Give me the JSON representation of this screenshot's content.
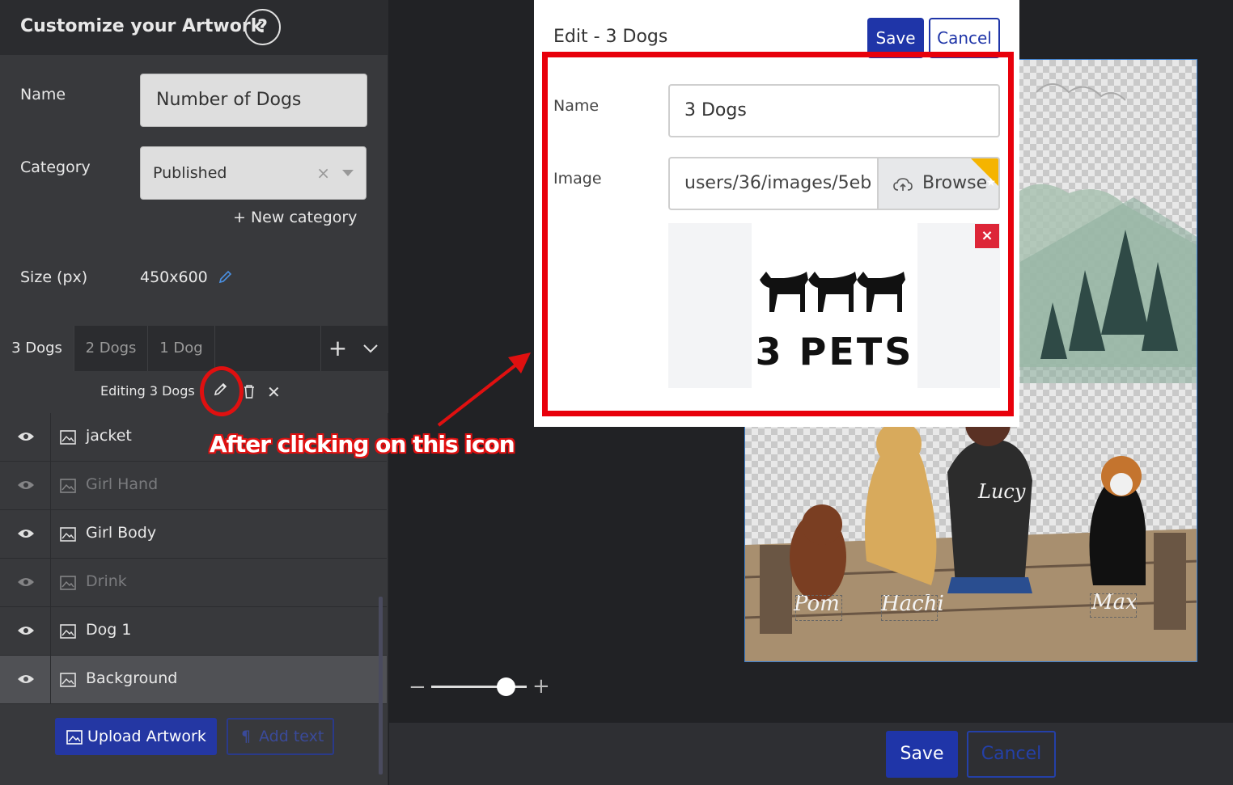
{
  "sidebar": {
    "title": "Customize your Artwork",
    "help_label": "?",
    "name_label": "Name",
    "name_value": "Number of Dogs",
    "category_label": "Category",
    "category_value": "Published",
    "category_clear": "×",
    "new_category": "+ New category",
    "size_label": "Size (px)",
    "size_value": "450x600",
    "tabs": [
      {
        "label": "3 Dogs",
        "active": true
      },
      {
        "label": "2 Dogs",
        "active": false
      },
      {
        "label": "1 Dog",
        "active": false
      }
    ],
    "tab_add": "+",
    "editing_label": "Editing 3 Dogs",
    "close_glyph": "✕",
    "layers": [
      {
        "name": "jacket",
        "visible": true,
        "selected": false
      },
      {
        "name": "Girl Hand",
        "visible": false,
        "selected": false
      },
      {
        "name": "Girl Body",
        "visible": true,
        "selected": false
      },
      {
        "name": "Drink",
        "visible": false,
        "selected": false
      },
      {
        "name": "Dog 1",
        "visible": true,
        "selected": false
      },
      {
        "name": "Background",
        "visible": true,
        "selected": true
      }
    ],
    "upload_button": "Upload Artwork",
    "add_text_button": "Add text",
    "add_text_glyph": "¶"
  },
  "canvas": {
    "labels": [
      "Pom",
      "Hachi",
      "Lucy",
      "Max"
    ],
    "zoom_minus": "−",
    "zoom_plus": "+",
    "zoom_level": 0.78
  },
  "modal": {
    "title": "Edit - 3 Dogs",
    "save": "Save",
    "cancel": "Cancel",
    "name_label": "Name",
    "name_value": "3 Dogs",
    "image_label": "Image",
    "image_value": "users/36/images/5eb",
    "browse": "Browse",
    "preview_text": "3 PETS",
    "remove_glyph": "×",
    "badge_star": "★"
  },
  "footer": {
    "save": "Save",
    "cancel": "Cancel"
  },
  "annotation": {
    "text": "After clicking on this icon"
  },
  "colors": {
    "accent": "#1f35a8",
    "annotation_red": "#e01010",
    "panel_bg": "#38393c",
    "canvas_bg": "#212225",
    "badge": "#f5b400"
  }
}
